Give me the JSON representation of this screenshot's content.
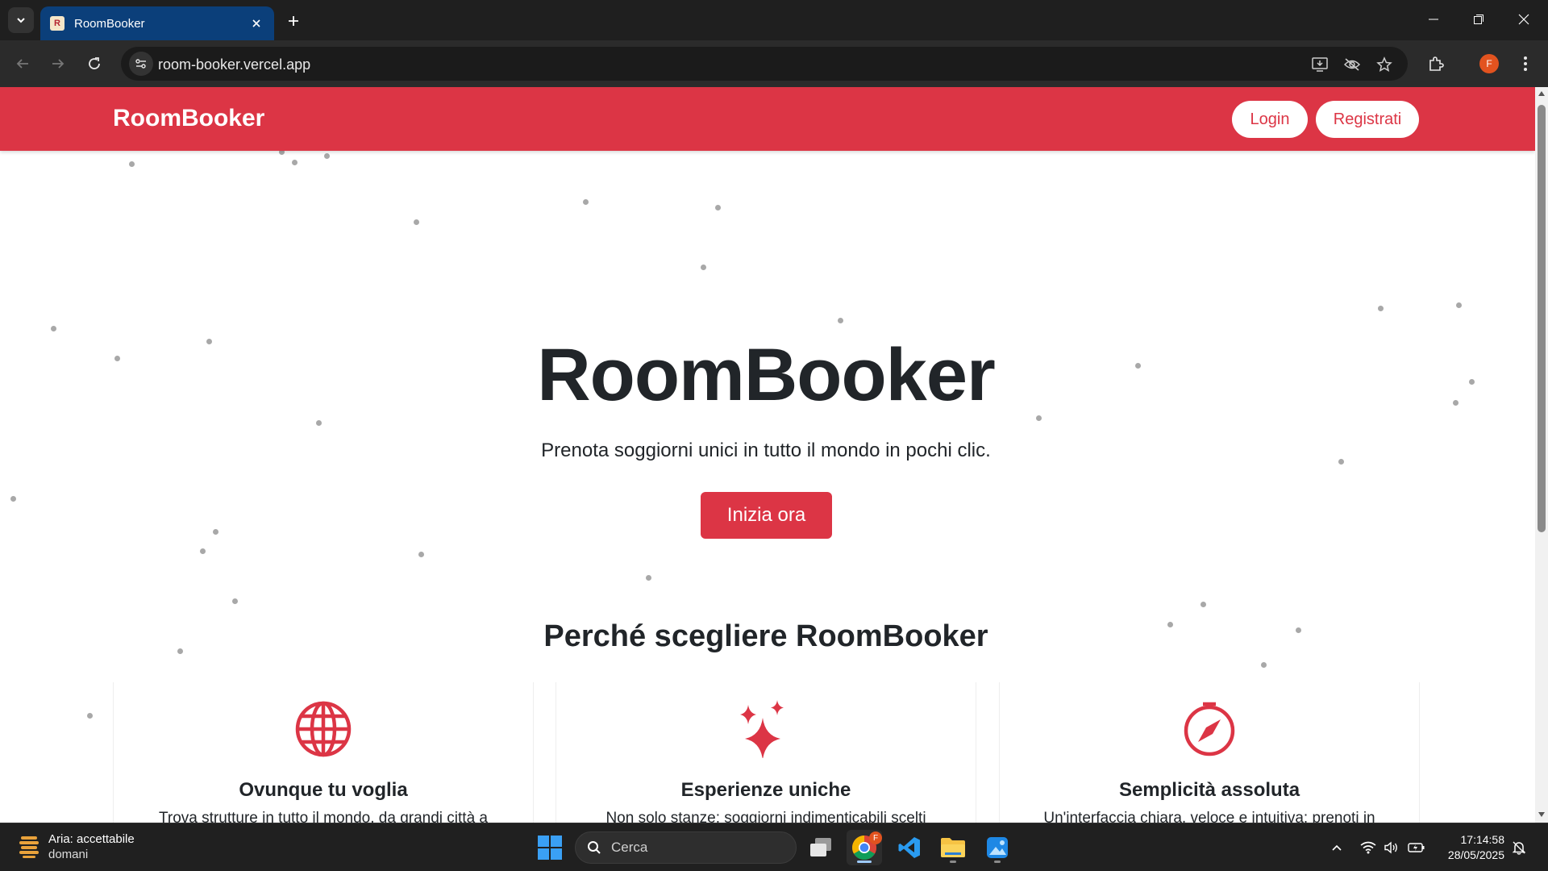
{
  "browser": {
    "tab_title": "RoomBooker",
    "favicon_letter": "R",
    "url": "room-booker.vercel.app",
    "profile_initial": "F"
  },
  "site": {
    "brand": "RoomBooker",
    "nav": {
      "login": "Login",
      "register": "Registrati"
    },
    "hero": {
      "title": "RoomBooker",
      "subtitle": "Prenota soggiorni unici in tutto il mondo in pochi clic.",
      "cta": "Inizia ora"
    },
    "features_title": "Perché scegliere RoomBooker",
    "features": [
      {
        "icon": "globe-icon",
        "title": "Ovunque tu voglia",
        "text": "Trova strutture in tutto il mondo, da grandi città a"
      },
      {
        "icon": "sparkles-icon",
        "title": "Esperienze uniche",
        "text": "Non solo stanze: soggiorni indimenticabili scelti"
      },
      {
        "icon": "compass-icon",
        "title": "Semplicità assoluta",
        "text": "Un'interfaccia chiara, veloce e intuitiva: prenoti in"
      }
    ],
    "accent_color": "#dc3545"
  },
  "taskbar": {
    "weather_line1": "Aria: accettabile",
    "weather_line2": "domani",
    "search_placeholder": "Cerca",
    "chrome_badge": "F",
    "time": "17:14:58",
    "date": "28/05/2025"
  }
}
